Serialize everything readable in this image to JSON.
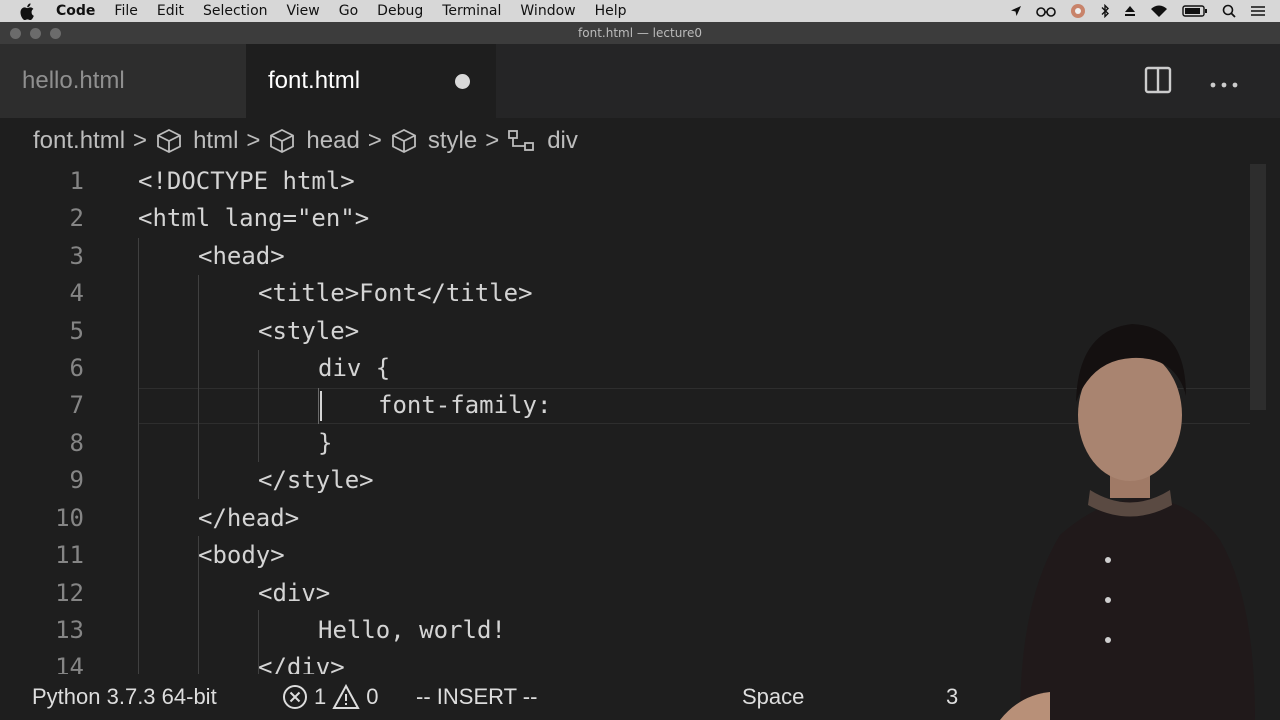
{
  "menubar": {
    "items": [
      "Code",
      "File",
      "Edit",
      "Selection",
      "View",
      "Go",
      "Debug",
      "Terminal",
      "Window",
      "Help"
    ]
  },
  "window": {
    "title": "font.html — lecture0"
  },
  "tabs": [
    {
      "label": "hello.html",
      "active": false
    },
    {
      "label": "font.html",
      "active": true,
      "dirty": true
    }
  ],
  "breadcrumb": [
    "font.html",
    "html",
    "head",
    "style",
    "div"
  ],
  "editor": {
    "lines": [
      {
        "n": "1",
        "text": "<!DOCTYPE html>"
      },
      {
        "n": "2",
        "text": "<html lang=\"en\">"
      },
      {
        "n": "3",
        "text": "<head>"
      },
      {
        "n": "4",
        "text": "<title>Font</title>"
      },
      {
        "n": "5",
        "text": "<style>"
      },
      {
        "n": "6",
        "text": "div {"
      },
      {
        "n": "7",
        "text": "font-family:"
      },
      {
        "n": "8",
        "text": "}"
      },
      {
        "n": "9",
        "text": "</style>"
      },
      {
        "n": "10",
        "text": "</head>"
      },
      {
        "n": "11",
        "text": "<body>"
      },
      {
        "n": "12",
        "text": "<div>"
      },
      {
        "n": "13",
        "text": "Hello, world!"
      },
      {
        "n": "14",
        "text": "</div>"
      }
    ]
  },
  "statusbar": {
    "python": "Python 3.7.3 64-bit",
    "errors": "1",
    "warnings": "0",
    "mode": "-- INSERT --",
    "spaces": "Space",
    "trailing": "3"
  },
  "colors": {
    "editor_bg": "#1e1e1e",
    "tab_bg": "#252526",
    "menubar_bg": "#d7d7d7"
  }
}
